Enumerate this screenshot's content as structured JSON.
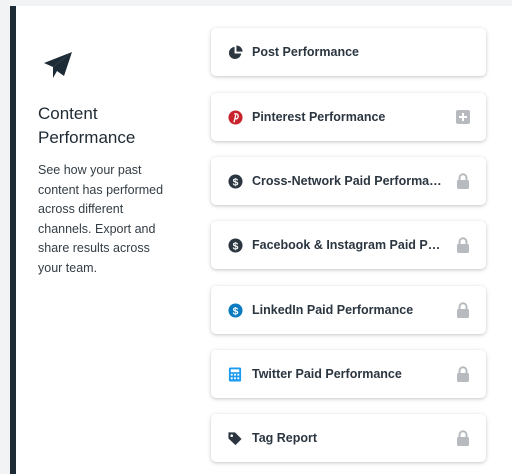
{
  "intro": {
    "icon": "paper-plane-icon",
    "title": "Content Performance",
    "description": "See how your past content has performed across different channels. Export and share results across your team."
  },
  "reports": [
    {
      "label": "Post Performance",
      "icon": "pie-chart-icon",
      "status": "none"
    },
    {
      "label": "Pinterest Performance",
      "icon": "pinterest-icon",
      "status": "add"
    },
    {
      "label": "Cross-Network Paid Performance",
      "icon": "dollar-circle-icon",
      "status": "locked"
    },
    {
      "label": "Facebook & Instagram Paid Performance",
      "icon": "dollar-circle-icon",
      "status": "locked"
    },
    {
      "label": "LinkedIn Paid Performance",
      "icon": "dollar-circle-icon",
      "status": "locked"
    },
    {
      "label": "Twitter Paid Performance",
      "icon": "calculator-icon",
      "status": "locked"
    },
    {
      "label": "Tag Report",
      "icon": "tag-icon",
      "status": "locked"
    }
  ],
  "colors": {
    "sidebar_border": "#1c2b36",
    "pinterest": "#c8232c",
    "linkedin": "#0a7bc0",
    "twitter": "#1d9bf0",
    "icon_dark": "#2b3640",
    "muted": "#b7bbbf"
  }
}
